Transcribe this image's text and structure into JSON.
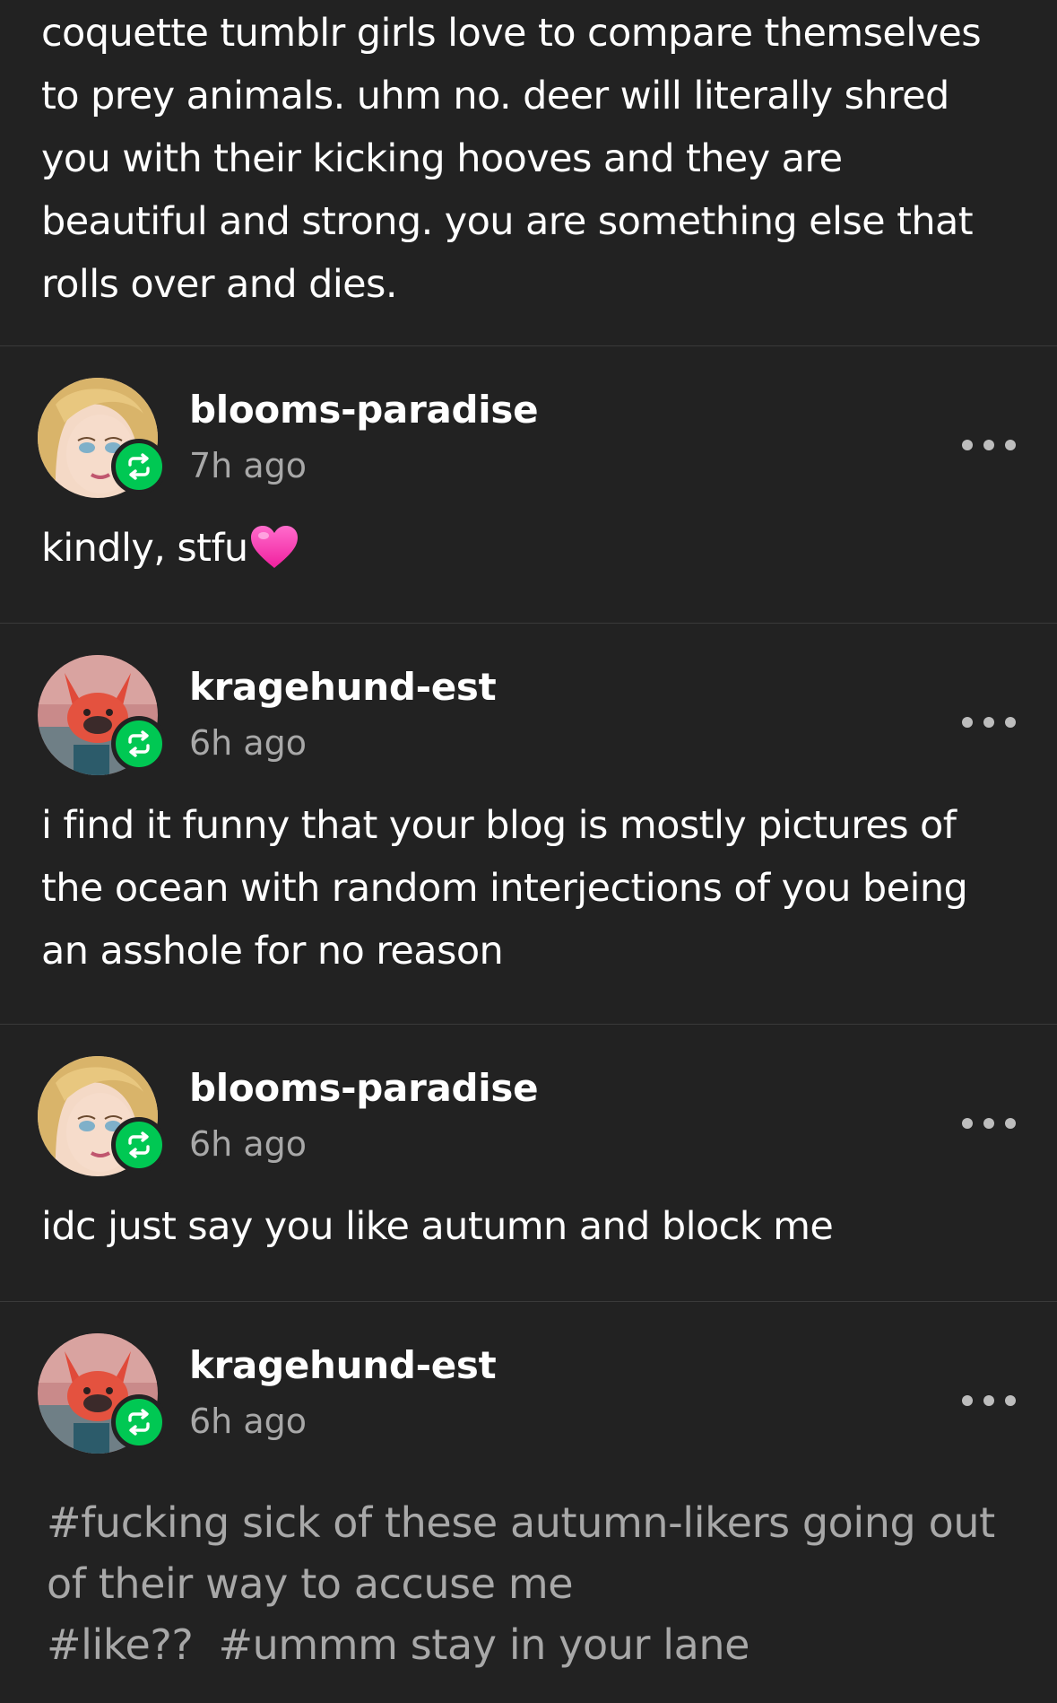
{
  "intro": {
    "text": "coquette tumblr girls love to compare themselves to prey animals. uhm no. deer will literally shred you with their kicking hooves and they are beautiful and strong. you are something else that rolls over and dies."
  },
  "replies": [
    {
      "username": "blooms-paradise",
      "time": "7h ago",
      "text": "kindly, stfu",
      "emoji": "pink-heart"
    },
    {
      "username": "kragehund-est",
      "time": "6h ago",
      "text": "i find it funny that your blog is mostly pictures of the ocean with random interjections of you being an asshole for no reason"
    },
    {
      "username": "blooms-paradise",
      "time": "6h ago",
      "text": "idc just say you like autumn and block me"
    },
    {
      "username": "kragehund-est",
      "time": "6h ago",
      "tags": [
        "#fucking sick of these autumn-likers going out of their way to accuse me",
        "#like??",
        "#ummm stay in your lane"
      ]
    }
  ],
  "icons": {
    "reblog": "reblog-icon",
    "more": "more-options-icon",
    "heart": "pink-heart-icon"
  },
  "colors": {
    "background": "#222222",
    "divider": "#3a3a3a",
    "text": "#ffffff",
    "muted": "#a8a8a8",
    "reblog_green": "#00c853",
    "heart_pink": "#ff3db4"
  }
}
